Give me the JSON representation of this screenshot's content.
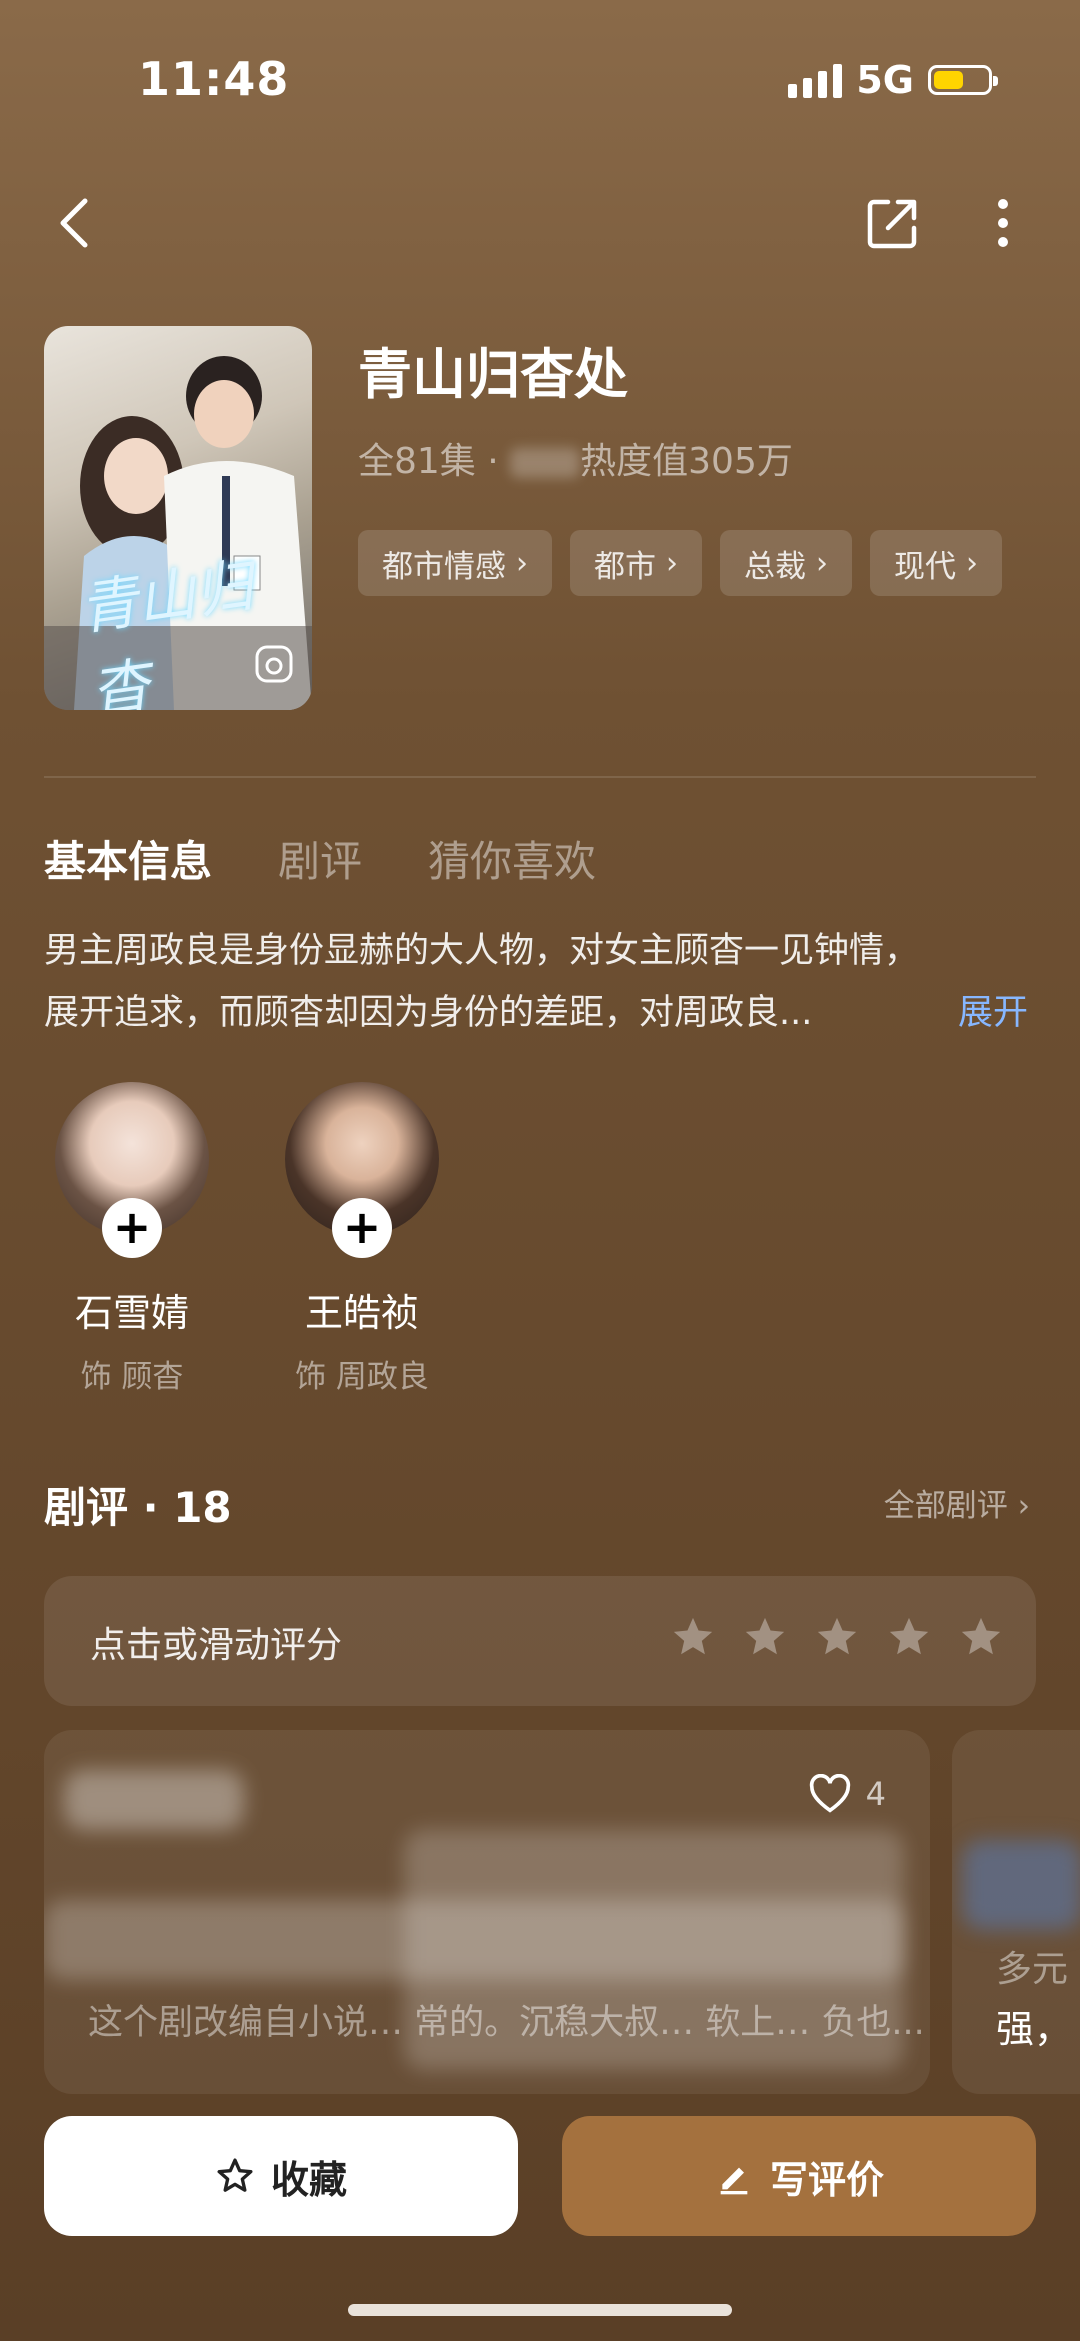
{
  "status_bar": {
    "time": "11:48",
    "network": "5G",
    "battery_color": "#ffd400",
    "battery_level": 0.55
  },
  "nav": {
    "back_icon": "chevron-left-icon",
    "share_icon": "share-icon",
    "more_icon": "more-vertical-icon"
  },
  "drama": {
    "title": "青山归杳处",
    "meta": "全81集 · ",
    "meta_heat": "热度值305万",
    "poster_title": "青山归杳",
    "tags": [
      "都市情感",
      "都市",
      "总裁",
      "现代"
    ]
  },
  "tabs": [
    "基本信息",
    "剧评",
    "猜你喜欢"
  ],
  "description": "男主周政良是身份显赫的大人物，对女主顾杳一见钟情，展开追求，而顾杳却因为身份的差距，对周政良...",
  "expand_label": "展开",
  "cast": [
    {
      "name": "石雪婧",
      "role": "饰 顾杳"
    },
    {
      "name": "王皓祯",
      "role": "饰 周政良"
    }
  ],
  "reviews": {
    "header": "剧评 · 18",
    "all_label": "全部剧评",
    "rate_prompt": "点击或滑动评分",
    "card1_likes": "4",
    "card1_snippet": "这个剧改编自小说… 常的。沉稳大叔… 软上… 负也...",
    "card2_line1": "多元",
    "card2_line2": "强，"
  },
  "actions": {
    "favorite": "收藏",
    "write_review": "写评价"
  },
  "colors": {
    "accent": "#a4713e",
    "link": "#87b7ff"
  }
}
